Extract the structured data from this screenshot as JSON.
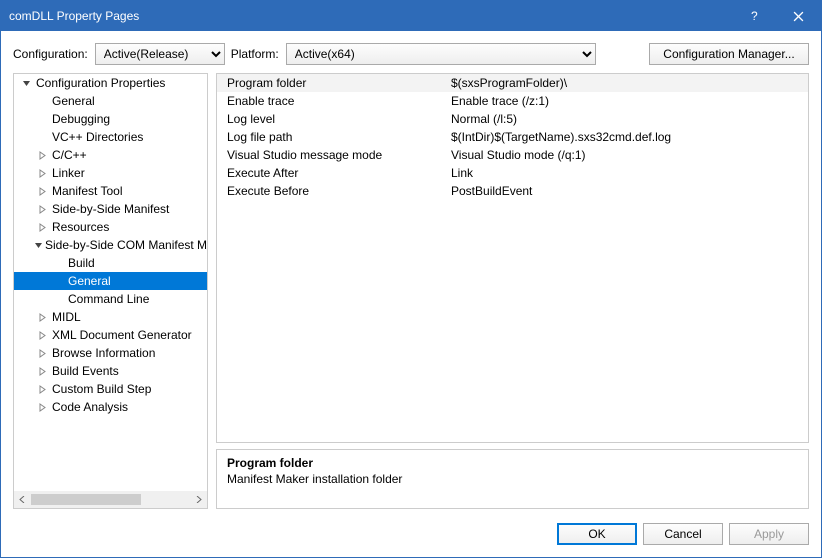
{
  "window": {
    "title": "comDLL Property Pages"
  },
  "configrow": {
    "config_label": "Configuration:",
    "config_value": "Active(Release)",
    "platform_label": "Platform:",
    "platform_value": "Active(x64)",
    "manager_btn": "Configuration Manager..."
  },
  "tree": {
    "root": "Configuration Properties",
    "items": [
      {
        "label": "General",
        "level": 1,
        "expander": ""
      },
      {
        "label": "Debugging",
        "level": 1,
        "expander": ""
      },
      {
        "label": "VC++ Directories",
        "level": 1,
        "expander": ""
      },
      {
        "label": "C/C++",
        "level": 1,
        "expander": "closed"
      },
      {
        "label": "Linker",
        "level": 1,
        "expander": "closed"
      },
      {
        "label": "Manifest Tool",
        "level": 1,
        "expander": "closed"
      },
      {
        "label": "Side-by-Side Manifest",
        "level": 1,
        "expander": "closed"
      },
      {
        "label": "Resources",
        "level": 1,
        "expander": "closed"
      },
      {
        "label": "Side-by-Side COM Manifest Maker",
        "level": 1,
        "expander": "open"
      },
      {
        "label": "Build",
        "level": 2,
        "expander": ""
      },
      {
        "label": "General",
        "level": 2,
        "expander": "",
        "selected": true
      },
      {
        "label": "Command Line",
        "level": 2,
        "expander": ""
      },
      {
        "label": "MIDL",
        "level": 1,
        "expander": "closed"
      },
      {
        "label": "XML Document Generator",
        "level": 1,
        "expander": "closed"
      },
      {
        "label": "Browse Information",
        "level": 1,
        "expander": "closed"
      },
      {
        "label": "Build Events",
        "level": 1,
        "expander": "closed"
      },
      {
        "label": "Custom Build Step",
        "level": 1,
        "expander": "closed"
      },
      {
        "label": "Code Analysis",
        "level": 1,
        "expander": "closed"
      }
    ]
  },
  "props": [
    {
      "k": "Program folder",
      "v": "$(sxsProgramFolder)\\",
      "selected": true
    },
    {
      "k": "Enable trace",
      "v": "Enable trace (/z:1)"
    },
    {
      "k": "Log level",
      "v": "Normal (/l:5)"
    },
    {
      "k": "Log file path",
      "v": "$(IntDir)$(TargetName).sxs32cmd.def.log"
    },
    {
      "k": "Visual Studio message mode",
      "v": "Visual Studio mode (/q:1)"
    },
    {
      "k": "Execute After",
      "v": "Link"
    },
    {
      "k": "Execute Before",
      "v": "PostBuildEvent"
    }
  ],
  "help": {
    "title": "Program folder",
    "desc": "Manifest Maker installation folder"
  },
  "footer": {
    "ok": "OK",
    "cancel": "Cancel",
    "apply": "Apply"
  }
}
